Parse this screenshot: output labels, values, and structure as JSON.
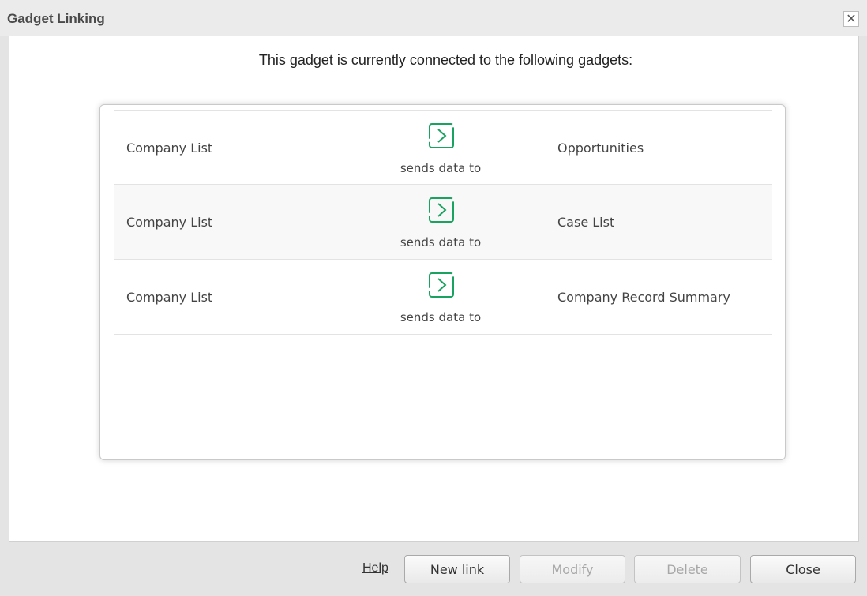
{
  "dialog": {
    "title": "Gadget Linking",
    "close_icon_glyph": "✕"
  },
  "content": {
    "heading": "This gadget is currently connected to the following gadgets:"
  },
  "links": [
    {
      "source": "Company List",
      "relation": "sends data to",
      "target": "Opportunities"
    },
    {
      "source": "Company List",
      "relation": "sends data to",
      "target": "Case List"
    },
    {
      "source": "Company List",
      "relation": "sends data to",
      "target": "Company Record Summary"
    }
  ],
  "footer": {
    "help": "Help",
    "new_link": "New link",
    "modify": "Modify",
    "delete": "Delete",
    "close": "Close"
  },
  "colors": {
    "accent": "#1aa260"
  },
  "icons": {
    "link_arrow": "chevron-right-bracket-icon"
  }
}
